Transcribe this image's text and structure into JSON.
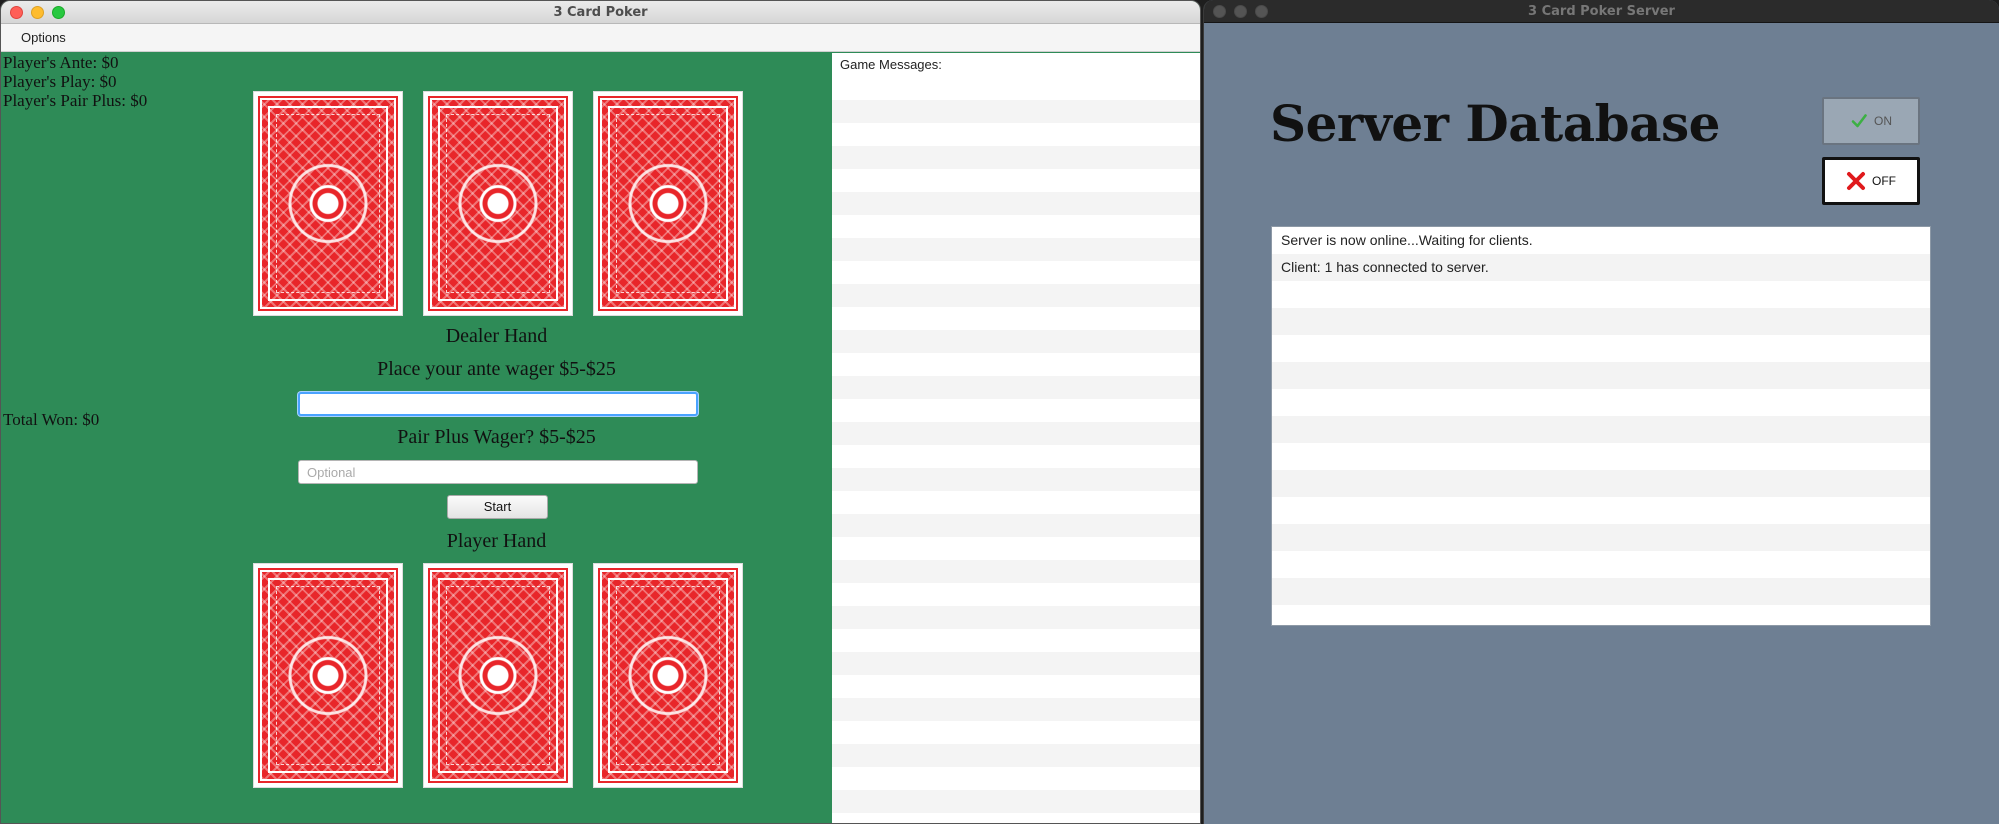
{
  "client": {
    "window_title": "3 Card Poker",
    "menu": {
      "options_label": "Options"
    },
    "stats": {
      "ante": "Player's Ante: $0",
      "play": "Player's Play: $0",
      "pair_plus": "Player's Pair Plus: $0"
    },
    "total_won": "Total Won: $0",
    "dealer_hand_label": "Dealer Hand",
    "ante_prompt": "Place your ante wager $5-$25",
    "ante_input": {
      "value": "",
      "placeholder": ""
    },
    "pair_plus_prompt": "Pair Plus Wager? $5-$25",
    "pair_plus_input": {
      "value": "",
      "placeholder": "Optional"
    },
    "start_label": "Start",
    "player_hand_label": "Player Hand",
    "messages_header": "Game Messages:",
    "dealer_cards": [
      "card-back",
      "card-back",
      "card-back"
    ],
    "player_cards": [
      "card-back",
      "card-back",
      "card-back"
    ]
  },
  "server": {
    "window_title": "3 Card Poker Server",
    "heading": "Server Database",
    "on_label": "ON",
    "off_label": "OFF",
    "log": [
      "Server is now online...Waiting for clients.",
      "Client: 1 has connected to server."
    ]
  },
  "colors": {
    "felt_green": "#2e8b57",
    "card_red": "#e8262a",
    "server_bg": "#6e7f93",
    "check_green": "#3cb043",
    "x_red": "#e0191c"
  }
}
